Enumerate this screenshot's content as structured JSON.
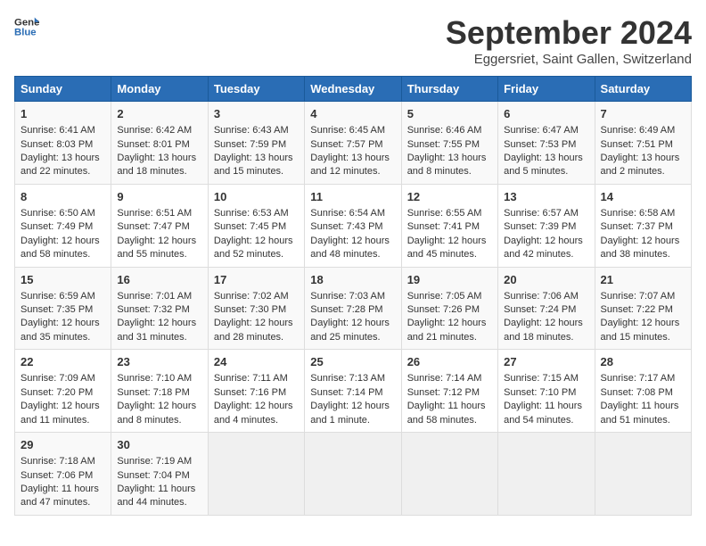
{
  "header": {
    "logo_line1": "General",
    "logo_line2": "Blue",
    "month": "September 2024",
    "location": "Eggersriet, Saint Gallen, Switzerland"
  },
  "weekdays": [
    "Sunday",
    "Monday",
    "Tuesday",
    "Wednesday",
    "Thursday",
    "Friday",
    "Saturday"
  ],
  "weeks": [
    [
      {
        "day": "1",
        "lines": [
          "Sunrise: 6:41 AM",
          "Sunset: 8:03 PM",
          "Daylight: 13 hours",
          "and 22 minutes."
        ]
      },
      {
        "day": "2",
        "lines": [
          "Sunrise: 6:42 AM",
          "Sunset: 8:01 PM",
          "Daylight: 13 hours",
          "and 18 minutes."
        ]
      },
      {
        "day": "3",
        "lines": [
          "Sunrise: 6:43 AM",
          "Sunset: 7:59 PM",
          "Daylight: 13 hours",
          "and 15 minutes."
        ]
      },
      {
        "day": "4",
        "lines": [
          "Sunrise: 6:45 AM",
          "Sunset: 7:57 PM",
          "Daylight: 13 hours",
          "and 12 minutes."
        ]
      },
      {
        "day": "5",
        "lines": [
          "Sunrise: 6:46 AM",
          "Sunset: 7:55 PM",
          "Daylight: 13 hours",
          "and 8 minutes."
        ]
      },
      {
        "day": "6",
        "lines": [
          "Sunrise: 6:47 AM",
          "Sunset: 7:53 PM",
          "Daylight: 13 hours",
          "and 5 minutes."
        ]
      },
      {
        "day": "7",
        "lines": [
          "Sunrise: 6:49 AM",
          "Sunset: 7:51 PM",
          "Daylight: 13 hours",
          "and 2 minutes."
        ]
      }
    ],
    [
      {
        "day": "8",
        "lines": [
          "Sunrise: 6:50 AM",
          "Sunset: 7:49 PM",
          "Daylight: 12 hours",
          "and 58 minutes."
        ]
      },
      {
        "day": "9",
        "lines": [
          "Sunrise: 6:51 AM",
          "Sunset: 7:47 PM",
          "Daylight: 12 hours",
          "and 55 minutes."
        ]
      },
      {
        "day": "10",
        "lines": [
          "Sunrise: 6:53 AM",
          "Sunset: 7:45 PM",
          "Daylight: 12 hours",
          "and 52 minutes."
        ]
      },
      {
        "day": "11",
        "lines": [
          "Sunrise: 6:54 AM",
          "Sunset: 7:43 PM",
          "Daylight: 12 hours",
          "and 48 minutes."
        ]
      },
      {
        "day": "12",
        "lines": [
          "Sunrise: 6:55 AM",
          "Sunset: 7:41 PM",
          "Daylight: 12 hours",
          "and 45 minutes."
        ]
      },
      {
        "day": "13",
        "lines": [
          "Sunrise: 6:57 AM",
          "Sunset: 7:39 PM",
          "Daylight: 12 hours",
          "and 42 minutes."
        ]
      },
      {
        "day": "14",
        "lines": [
          "Sunrise: 6:58 AM",
          "Sunset: 7:37 PM",
          "Daylight: 12 hours",
          "and 38 minutes."
        ]
      }
    ],
    [
      {
        "day": "15",
        "lines": [
          "Sunrise: 6:59 AM",
          "Sunset: 7:35 PM",
          "Daylight: 12 hours",
          "and 35 minutes."
        ]
      },
      {
        "day": "16",
        "lines": [
          "Sunrise: 7:01 AM",
          "Sunset: 7:32 PM",
          "Daylight: 12 hours",
          "and 31 minutes."
        ]
      },
      {
        "day": "17",
        "lines": [
          "Sunrise: 7:02 AM",
          "Sunset: 7:30 PM",
          "Daylight: 12 hours",
          "and 28 minutes."
        ]
      },
      {
        "day": "18",
        "lines": [
          "Sunrise: 7:03 AM",
          "Sunset: 7:28 PM",
          "Daylight: 12 hours",
          "and 25 minutes."
        ]
      },
      {
        "day": "19",
        "lines": [
          "Sunrise: 7:05 AM",
          "Sunset: 7:26 PM",
          "Daylight: 12 hours",
          "and 21 minutes."
        ]
      },
      {
        "day": "20",
        "lines": [
          "Sunrise: 7:06 AM",
          "Sunset: 7:24 PM",
          "Daylight: 12 hours",
          "and 18 minutes."
        ]
      },
      {
        "day": "21",
        "lines": [
          "Sunrise: 7:07 AM",
          "Sunset: 7:22 PM",
          "Daylight: 12 hours",
          "and 15 minutes."
        ]
      }
    ],
    [
      {
        "day": "22",
        "lines": [
          "Sunrise: 7:09 AM",
          "Sunset: 7:20 PM",
          "Daylight: 12 hours",
          "and 11 minutes."
        ]
      },
      {
        "day": "23",
        "lines": [
          "Sunrise: 7:10 AM",
          "Sunset: 7:18 PM",
          "Daylight: 12 hours",
          "and 8 minutes."
        ]
      },
      {
        "day": "24",
        "lines": [
          "Sunrise: 7:11 AM",
          "Sunset: 7:16 PM",
          "Daylight: 12 hours",
          "and 4 minutes."
        ]
      },
      {
        "day": "25",
        "lines": [
          "Sunrise: 7:13 AM",
          "Sunset: 7:14 PM",
          "Daylight: 12 hours",
          "and 1 minute."
        ]
      },
      {
        "day": "26",
        "lines": [
          "Sunrise: 7:14 AM",
          "Sunset: 7:12 PM",
          "Daylight: 11 hours",
          "and 58 minutes."
        ]
      },
      {
        "day": "27",
        "lines": [
          "Sunrise: 7:15 AM",
          "Sunset: 7:10 PM",
          "Daylight: 11 hours",
          "and 54 minutes."
        ]
      },
      {
        "day": "28",
        "lines": [
          "Sunrise: 7:17 AM",
          "Sunset: 7:08 PM",
          "Daylight: 11 hours",
          "and 51 minutes."
        ]
      }
    ],
    [
      {
        "day": "29",
        "lines": [
          "Sunrise: 7:18 AM",
          "Sunset: 7:06 PM",
          "Daylight: 11 hours",
          "and 47 minutes."
        ]
      },
      {
        "day": "30",
        "lines": [
          "Sunrise: 7:19 AM",
          "Sunset: 7:04 PM",
          "Daylight: 11 hours",
          "and 44 minutes."
        ]
      },
      {
        "day": "",
        "lines": []
      },
      {
        "day": "",
        "lines": []
      },
      {
        "day": "",
        "lines": []
      },
      {
        "day": "",
        "lines": []
      },
      {
        "day": "",
        "lines": []
      }
    ]
  ]
}
